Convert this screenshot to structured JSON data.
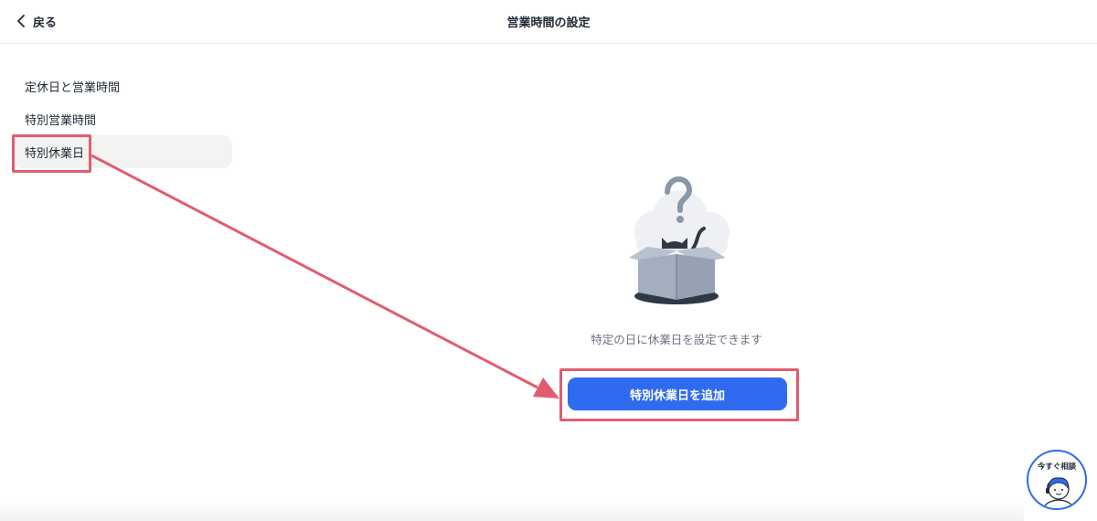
{
  "header": {
    "back_label": "戻る",
    "title": "営業時間の設定"
  },
  "sidebar": {
    "items": [
      {
        "label": "定休日と営業時間",
        "active": false
      },
      {
        "label": "特別営業時間",
        "active": false
      },
      {
        "label": "特別休業日",
        "active": true
      }
    ]
  },
  "main": {
    "empty_message": "特定の日に休業日を設定できます",
    "add_button_label": "特別休業日を追加",
    "illustration_icon": "cat-in-box-question-icon"
  },
  "chat": {
    "label": "今すぐ相談",
    "icon": "support-agent-avatar-icon"
  },
  "colors": {
    "primary": "#2f6bf0",
    "annotation": "#e05d6f",
    "active_bg": "#f3f3f1",
    "text": "#1f2a37",
    "muted_text": "#6b7280"
  }
}
